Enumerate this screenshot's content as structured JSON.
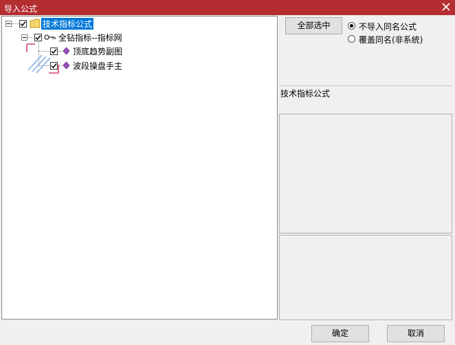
{
  "window": {
    "title": "导入公式"
  },
  "tree": {
    "root": {
      "label": "技术指标公式",
      "checked": true,
      "expanded": true
    },
    "child": {
      "label": "全钻指标--指标网",
      "checked": true,
      "expanded": true
    },
    "leaves": [
      {
        "label": "顶底趋势副图",
        "checked": true
      },
      {
        "label": "波段操盘手主",
        "checked": true
      }
    ]
  },
  "right": {
    "select_all_label": "全部选中",
    "options": [
      {
        "label": "不导入同名公式",
        "selected": true
      },
      {
        "label": "覆盖同名(非系统)",
        "selected": false
      }
    ],
    "info_title": "技术指标公式"
  },
  "footer": {
    "ok_label": "确定",
    "cancel_label": "取消"
  },
  "colors": {
    "titlebar": "#b42d31",
    "selection": "#0078d7"
  }
}
